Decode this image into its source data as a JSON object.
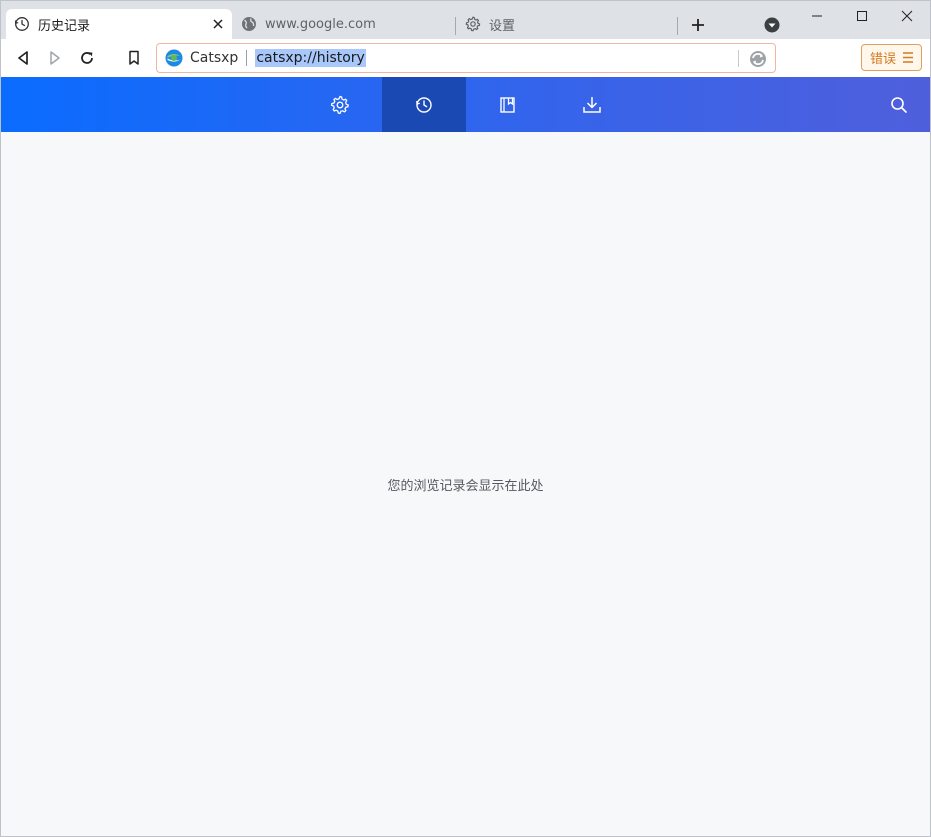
{
  "tabs": [
    {
      "title": "历史记录",
      "icon": "history-icon",
      "active": true
    },
    {
      "title": "www.google.com",
      "icon": "globe-icon",
      "active": false
    },
    {
      "title": "设置",
      "icon": "gear-icon",
      "active": false
    }
  ],
  "toolbar": {
    "site_name": "Catsxp",
    "url": "catsxp://history",
    "error_label": "错误"
  },
  "nav": {
    "items": [
      "settings-icon",
      "history-icon",
      "bookmarks-icon",
      "downloads-icon"
    ],
    "active": "history-icon"
  },
  "content": {
    "empty_message": "您的浏览记录会显示在此处"
  },
  "colors": {
    "nav_start": "#0a6cff",
    "nav_end": "#4f5fdc",
    "nav_active": "#1a49b4",
    "omnibox_border": "#f0b69e",
    "error_accent": "#d6781c",
    "url_highlight": "#a8c7fa"
  }
}
